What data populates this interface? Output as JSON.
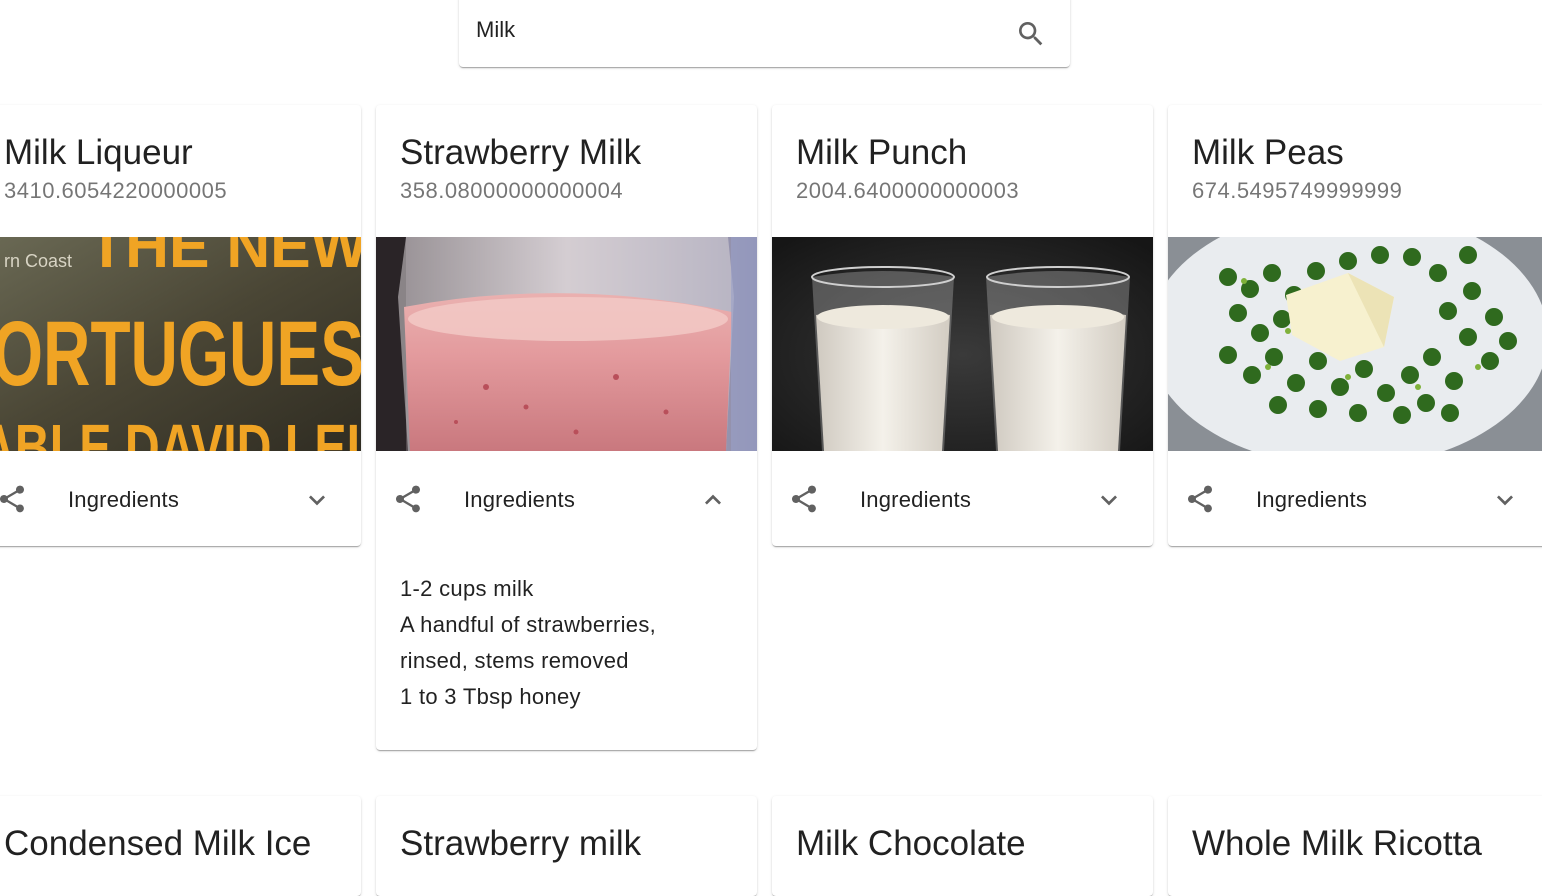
{
  "search": {
    "value": "Milk",
    "icon": "search-icon"
  },
  "cards": [
    {
      "title": "Milk Liqueur",
      "subheader": "3410.6054220000005",
      "media": {
        "description": "book cover photo",
        "text_lines": [
          "rn Coast",
          "THE NEW",
          "ORTUGUES",
          "ABLE DAVID LEI"
        ]
      },
      "ingredients_label": "Ingredients",
      "expanded": false
    },
    {
      "title": "Strawberry Milk",
      "subheader": "358.08000000000004",
      "ingredients_label": "Ingredients",
      "expanded": true,
      "ingredients": [
        "1-2 cups milk",
        "A handful of strawberries,",
        "rinsed, stems removed",
        "1 to 3 Tbsp honey"
      ]
    },
    {
      "title": "Milk Punch",
      "subheader": "2004.6400000000003",
      "ingredients_label": "Ingredients",
      "expanded": false
    },
    {
      "title": "Milk Peas",
      "subheader": "674.5495749999999",
      "ingredients_label": "Ingredients",
      "expanded": false
    },
    {
      "title": "Condensed Milk Ice"
    },
    {
      "title": "Strawberry milk"
    },
    {
      "title": "Milk Chocolate"
    },
    {
      "title": "Whole Milk Ricotta"
    }
  ],
  "colors": {
    "primary_text": "#212121",
    "secondary_text": "#757575",
    "icon": "#616161"
  }
}
